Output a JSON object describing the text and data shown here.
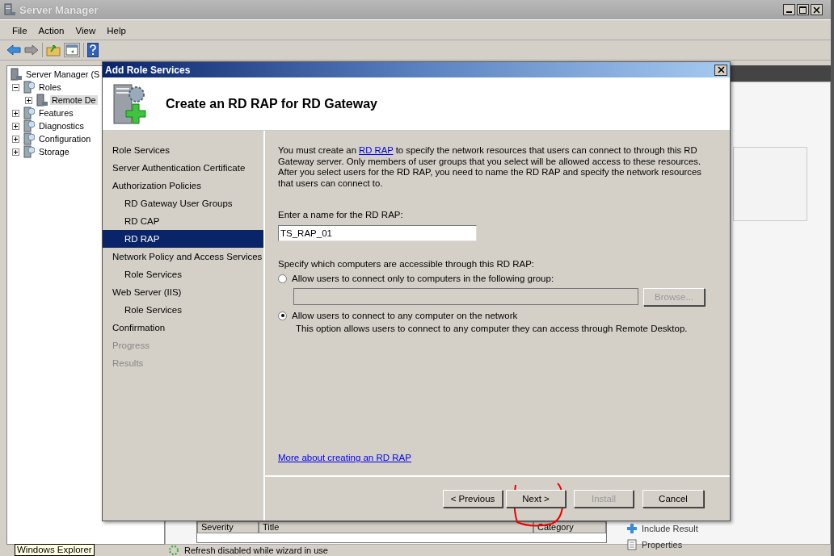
{
  "main_window": {
    "title": "Server Manager",
    "menu": [
      "File",
      "Action",
      "View",
      "Help"
    ],
    "tree": [
      {
        "label": "Server Manager (S",
        "selected": false,
        "children": [
          {
            "label": "Roles",
            "expanded": true,
            "selected": false,
            "children": [
              {
                "label": "Remote De",
                "expanded": false,
                "selected": true
              }
            ]
          },
          {
            "label": "Features",
            "expanded": false,
            "selected": false
          },
          {
            "label": "Diagnostics",
            "expanded": false,
            "selected": false
          },
          {
            "label": "Configuration",
            "expanded": false,
            "selected": false
          },
          {
            "label": "Storage",
            "expanded": false,
            "selected": false
          }
        ]
      }
    ],
    "results_table": {
      "columns": [
        "Severity",
        "Title",
        "Category"
      ]
    },
    "actions": [
      "Include Result",
      "Properties"
    ],
    "status_bar": "Refresh disabled while wizard in use"
  },
  "tooltip": "Windows Explorer",
  "dialog": {
    "title": "Add Role Services",
    "heading": "Create an RD RAP for RD Gateway",
    "steps": [
      {
        "label": "Role Services",
        "selected": false,
        "disabled": false
      },
      {
        "label": "Server Authentication Certificate",
        "selected": false,
        "disabled": false
      },
      {
        "label": "Authorization Policies",
        "selected": false,
        "disabled": false,
        "children": [
          {
            "label": "RD Gateway User Groups",
            "selected": false,
            "disabled": false
          },
          {
            "label": "RD CAP",
            "selected": false,
            "disabled": false
          },
          {
            "label": "RD RAP",
            "selected": true,
            "disabled": false
          }
        ]
      },
      {
        "label": "Network Policy and Access Services",
        "selected": false,
        "disabled": false,
        "children": [
          {
            "label": "Role Services",
            "selected": false,
            "disabled": false
          }
        ]
      },
      {
        "label": "Web Server (IIS)",
        "selected": false,
        "disabled": false,
        "children": [
          {
            "label": "Role Services",
            "selected": false,
            "disabled": false
          }
        ]
      },
      {
        "label": "Confirmation",
        "selected": false,
        "disabled": false
      },
      {
        "label": "Progress",
        "selected": false,
        "disabled": true
      },
      {
        "label": "Results",
        "selected": false,
        "disabled": true
      }
    ],
    "intro": {
      "before": "You must create an ",
      "link": "RD RAP",
      "after": " to specify the network resources that users can connect to through this RD Gateway server. Only members of user groups that you select will be allowed access to these resources. After you select users for the RD RAP, you need to name the RD RAP and specify the network resources that users can connect to."
    },
    "name_label": "Enter a name for the RD RAP:",
    "name_value": "TS_RAP_01",
    "computers_label": "Specify which computers are accessible through this RD RAP:",
    "options": [
      {
        "label": "Allow users to connect only to computers in the following group:",
        "selected": false
      },
      {
        "label": "Allow users to connect to any computer on the network",
        "selected": true,
        "description": "This option allows users to connect to any computer they can access through Remote Desktop."
      }
    ],
    "group_field": {
      "disabled": true
    },
    "browse_button": {
      "label": "Browse...",
      "disabled": true
    },
    "more_link": "More about creating an RD RAP",
    "buttons": [
      {
        "label": "< Previous",
        "disabled": false
      },
      {
        "label": "Next >",
        "disabled": false
      },
      {
        "label": "Install",
        "disabled": true
      },
      {
        "label": "Cancel",
        "disabled": false
      }
    ]
  }
}
